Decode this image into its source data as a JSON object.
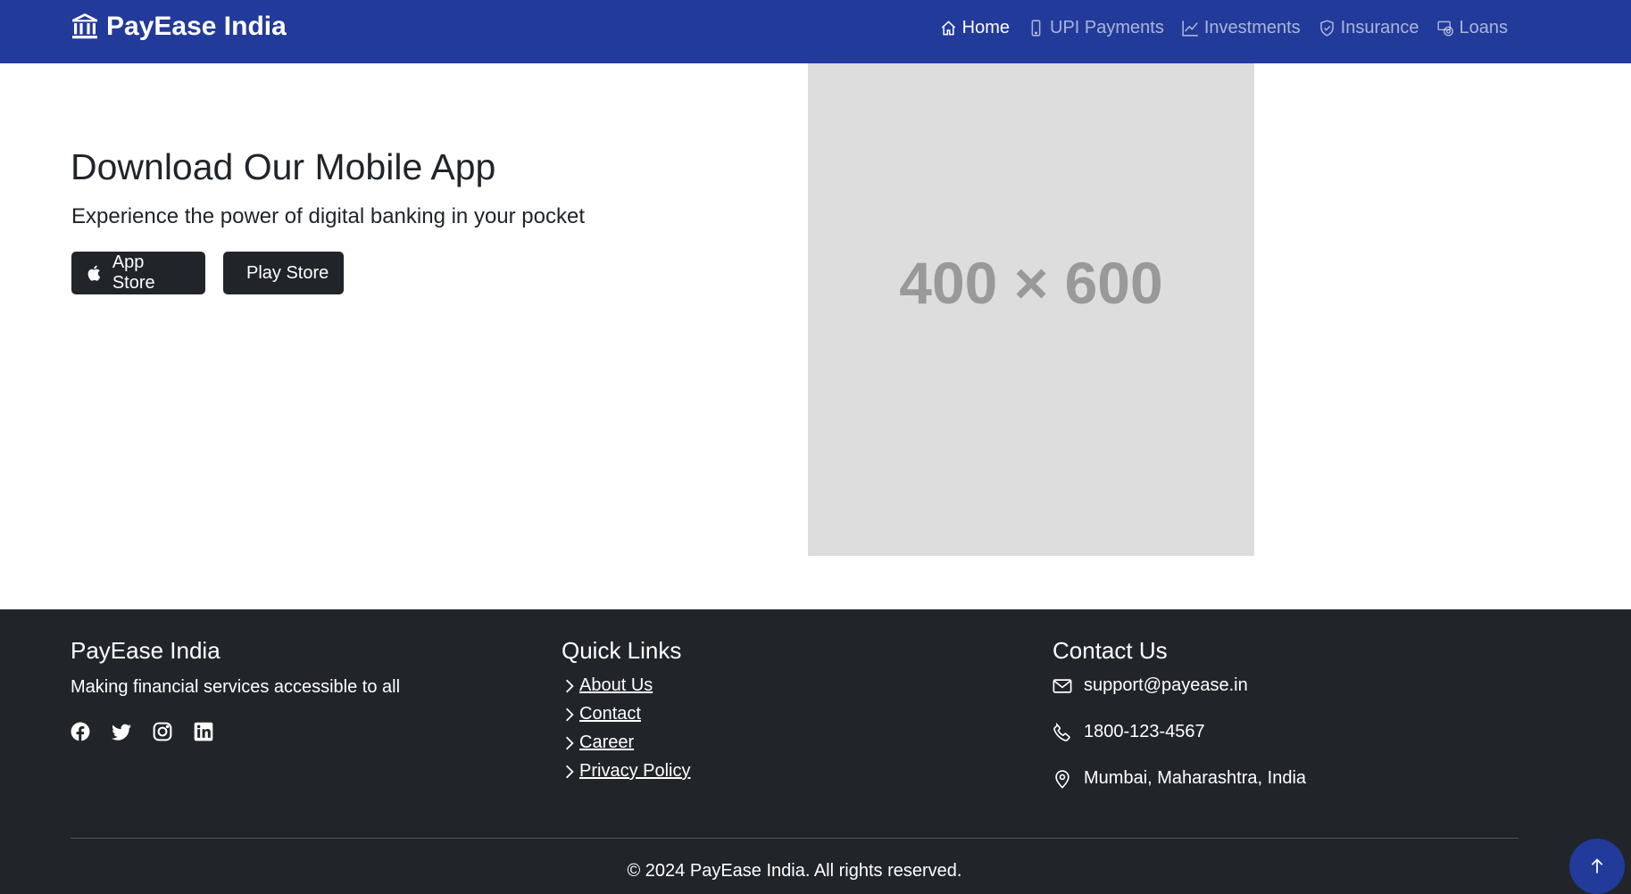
{
  "navbar": {
    "brand": "PayEase India",
    "brand_icon": "bank-icon",
    "items": [
      {
        "label": "Home",
        "icon": "house-icon",
        "active": true
      },
      {
        "label": "UPI Payments",
        "icon": "phone-icon",
        "active": false
      },
      {
        "label": "Investments",
        "icon": "graph-up-icon",
        "active": false
      },
      {
        "label": "Insurance",
        "icon": "shield-check-icon",
        "active": false
      },
      {
        "label": "Loans",
        "icon": "cash-coin-icon",
        "active": false
      }
    ]
  },
  "hero": {
    "title": "Download Our Mobile App",
    "subtitle": "Experience the power of digital banking in your pocket",
    "app_store_label": "App Store",
    "play_store_label": "Play Store",
    "image_placeholder": "400 × 600"
  },
  "footer": {
    "about": {
      "title": "PayEase India",
      "text": "Making financial services accessible to all",
      "social_icons": [
        "facebook-icon",
        "twitter-icon",
        "instagram-icon",
        "linkedin-icon"
      ]
    },
    "quick_links": {
      "title": "Quick Links",
      "items": [
        " About Us",
        " Contact",
        " Career",
        " Privacy Policy"
      ]
    },
    "contact": {
      "title": "Contact Us",
      "email": "support@payease.in",
      "phone": "1800-123-4567",
      "address": "Mumbai, Maharashtra, India"
    },
    "copyright": "© 2024 PayEase India. All rights reserved."
  },
  "colors": {
    "navbar_bg": "#223a9a",
    "footer_bg": "#212529",
    "button_bg": "#212529",
    "placeholder_bg": "#dddddd"
  }
}
